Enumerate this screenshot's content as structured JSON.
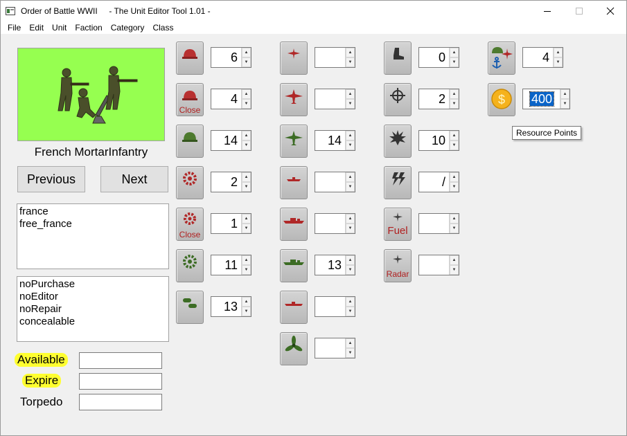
{
  "window": {
    "title": "Order of Battle WWII     - The Unit Editor Tool 1.01 -",
    "minimize_symbol": "—",
    "maximize_symbol": "☐",
    "close_symbol": "✕"
  },
  "menu": [
    "File",
    "Edit",
    "Unit",
    "Faction",
    "Category",
    "Class"
  ],
  "unit": {
    "name": "French MortarInfantry",
    "image_background": "#96ff50"
  },
  "nav": {
    "previous": "Previous",
    "next": "Next"
  },
  "factions": [
    "france",
    "free_france"
  ],
  "flags": [
    "noPurchase",
    "noEditor",
    "noRepair",
    "concealable"
  ],
  "fields": {
    "available_label": "Available",
    "expire_label": "Expire",
    "torpedo_label": "Torpedo",
    "available_value": "",
    "expire_value": "",
    "torpedo_value": ""
  },
  "stats": {
    "soft_attack": "6",
    "close_soft_attack": "4",
    "soft_defense": "14",
    "hard_attack": "2",
    "close_hard_attack": "1",
    "hard_defense": "11",
    "ammo": "13",
    "air_attack": "",
    "air_attack_2": "",
    "air_defense": "14",
    "naval_attack": "",
    "naval_attack_2": "",
    "naval_defense": "13",
    "submarine_attack": "",
    "propeller": "",
    "movement": "0",
    "range": "2",
    "initiative": "10",
    "special": "/",
    "fuel": "",
    "radar": "",
    "transport": "4",
    "resource_points": "400"
  },
  "captions": {
    "close": "Close",
    "fuel": "Fuel",
    "radar": "Radar"
  },
  "tooltip": "Resource Points",
  "colors": {
    "highlight": "#ffff30",
    "selection": "#0a64c8",
    "caption_red": "#b02020"
  }
}
